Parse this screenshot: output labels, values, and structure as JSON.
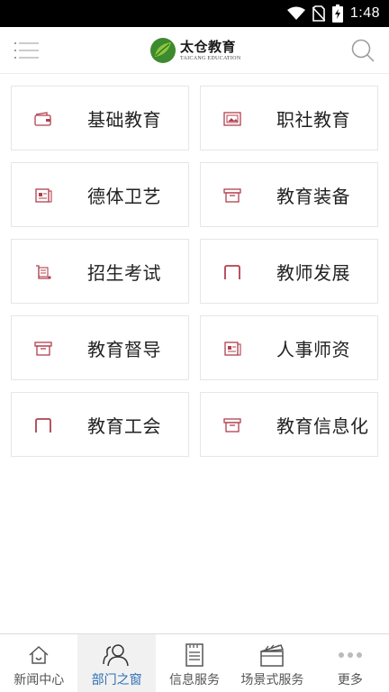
{
  "status_bar": {
    "time": "1:48"
  },
  "header": {
    "logo_title": "太仓教育",
    "logo_subtitle": "TAICANG EDUCATION"
  },
  "departments": [
    {
      "label": "基础教育",
      "icon": "wallet-icon"
    },
    {
      "label": "职社教育",
      "icon": "picture-icon"
    },
    {
      "label": "德体卫艺",
      "icon": "document-icon"
    },
    {
      "label": "教育装备",
      "icon": "box-icon"
    },
    {
      "label": "招生考试",
      "icon": "scroll-icon"
    },
    {
      "label": "教师发展",
      "icon": "frame-icon"
    },
    {
      "label": "教育督导",
      "icon": "box-icon"
    },
    {
      "label": "人事师资",
      "icon": "document-icon"
    },
    {
      "label": "教育工会",
      "icon": "frame-icon"
    },
    {
      "label": "教育信息化",
      "icon": "box-icon"
    }
  ],
  "bottom_nav": [
    {
      "label": "新闻中心",
      "icon": "home-icon"
    },
    {
      "label": "部门之窗",
      "icon": "people-icon",
      "active": true
    },
    {
      "label": "信息服务",
      "icon": "document-icon"
    },
    {
      "label": "场景式服务",
      "icon": "clapperboard-icon"
    },
    {
      "label": "更多",
      "icon": "more-icon"
    }
  ],
  "colors": {
    "accent": "#b1404f",
    "active_nav": "#2d6fb5",
    "logo_green": "#3e8a2e"
  }
}
